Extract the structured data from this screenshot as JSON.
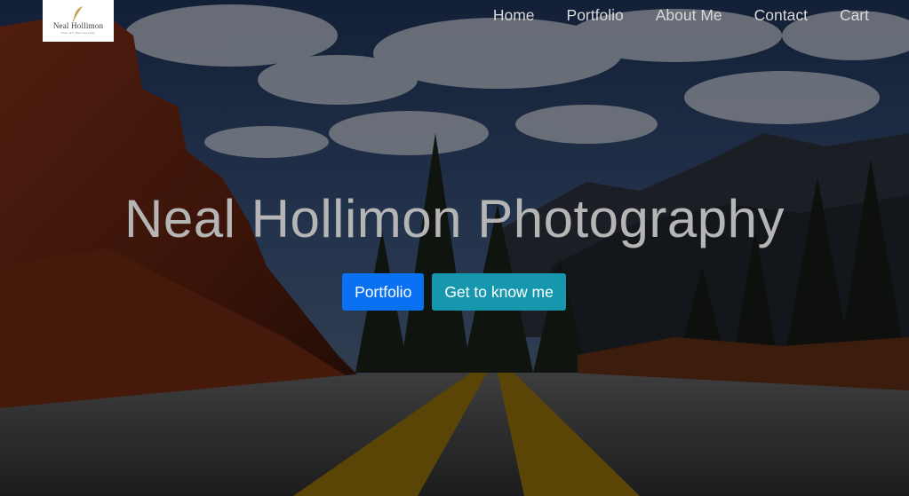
{
  "logo": {
    "name": "Neal Hollimon",
    "tagline": "Fine Art Photography",
    "background": "#ffffff",
    "icon": "feather-icon"
  },
  "nav": {
    "items": [
      {
        "label": "Home"
      },
      {
        "label": "Portfolio"
      },
      {
        "label": "About Me"
      },
      {
        "label": "Contact"
      },
      {
        "label": "Cart"
      }
    ]
  },
  "hero": {
    "title": "Neal Hollimon Photography",
    "primary_button": "Portfolio",
    "secondary_button": "Get to know me",
    "background_description_icon": "mountain-road-photo"
  },
  "colors": {
    "primary": "#0a72f2",
    "info": "#1797ad",
    "nav_text": "#d9d9d9",
    "title_text": "#b5b5b5"
  }
}
